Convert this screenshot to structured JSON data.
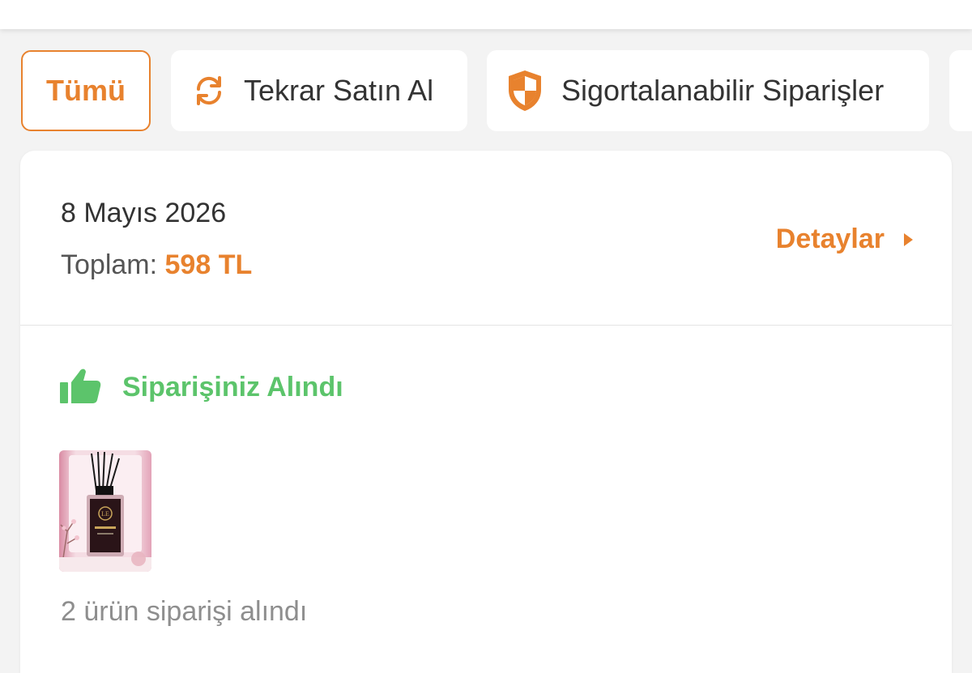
{
  "filters": {
    "all_label": "Tümü",
    "rebuy_label": "Tekrar Satın Al",
    "insurable_label": "Sigortalanabilir Siparişler"
  },
  "order": {
    "date": "8 Mayıs 2026",
    "total_label": "Toplam:",
    "total_amount": "598 TL",
    "details_label": "Detaylar",
    "status": "Siparişiniz Alındı",
    "items_summary": "2 ürün siparişi alındı",
    "product_logo_text": "LE"
  },
  "icons": {
    "rebuy": "refresh-icon",
    "insurable": "shield-icon",
    "status": "thumbs-up-icon",
    "details": "chevron-right-icon"
  },
  "colors": {
    "accent": "#e8822e",
    "success": "#5cc46b",
    "text_primary": "#333333",
    "text_muted": "#8e8e8e",
    "background": "#f3f3f3"
  }
}
